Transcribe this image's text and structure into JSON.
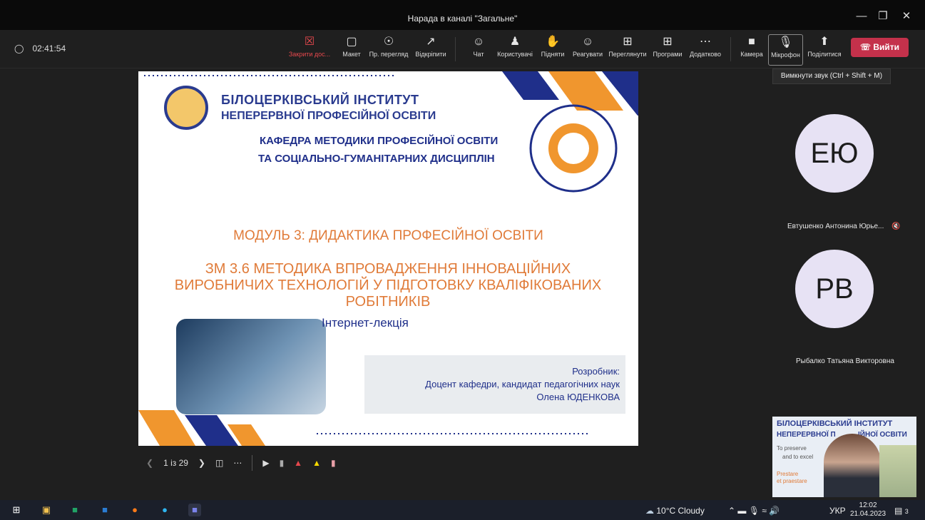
{
  "window": {
    "title": "Нарада в каналі \"Загальне\""
  },
  "meeting": {
    "elapsed": "02:41:54"
  },
  "toolbar": {
    "close_share": "Закрити дос...",
    "layout": "Макет",
    "preview": "Пр. перегляд",
    "popout": "Відкріпити",
    "chat": "Чат",
    "people": "Користувачі",
    "raise": "Підняти",
    "react": "Реагувати",
    "view": "Переглянути",
    "apps": "Програми",
    "more": "Додатково",
    "camera": "Камера",
    "mic": "Мікрофон",
    "share": "Поділитися",
    "leave": "Вийти"
  },
  "tooltip": {
    "text": "Вимкнути звук (Ctrl + Shift + M)"
  },
  "slide": {
    "inst_line1": "БІЛОЦЕРКІВСЬКИЙ ІНСТИТУТ",
    "inst_line2": "НЕПЕРЕРВНОЇ ПРОФЕСІЙНОЇ ОСВІТИ",
    "dept_line1": "КАФЕДРА МЕТОДИКИ ПРОФЕСІЙНОЇ ОСВІТИ",
    "dept_line2": "ТА СОЦІАЛЬНО-ГУМАНІТАРНИХ ДИСЦИПЛІН",
    "module": "МОДУЛЬ 3: ДИДАКТИКА ПРОФЕСІЙНОЇ ОСВІТИ",
    "topic": "ЗМ 3.6 МЕТОДИКА ВПРОВАДЖЕННЯ ІННОВАЦІЙНИХ ВИРОБНИЧИХ ТЕХНОЛОГІЙ У ПІДГОТОВКУ КВАЛІФІКОВАНИХ РОБІТНИКІВ",
    "lecture_type": "Інтернет-лекція",
    "author_role_label": "Розробник:",
    "author_position": "Доцент кафедри, кандидат педагогічних наук",
    "author_name": "Олена ЮДЕНКОВА"
  },
  "presenter_controls": {
    "page": "1 із 29"
  },
  "participants": [
    {
      "initials": "ЕЮ",
      "name": "Евтушенко Антонина Юрье..."
    },
    {
      "initials": "РВ",
      "name": "Рыбалко Татьяна Викторовна"
    }
  ],
  "self_view": {
    "line1": "БІЛОЦЕРКІВСЬКИЙ ІНСТИТУТ",
    "line2": "НЕПЕРЕРВНОЇ П",
    "line2b": "ІЙНОЇ ОСВІТИ",
    "text1": "To preserve",
    "text2": "and to excel",
    "text3": "Prestare",
    "text4": "et praestare"
  },
  "taskbar": {
    "weather": "10°C Cloudy",
    "lang": "УКР",
    "time": "12:02",
    "date": "21.04.2023",
    "notifications": "3"
  },
  "colors": {
    "leave": "#c4314b",
    "slide_orange": "#e07b39",
    "slide_blue": "#1f2f8a"
  }
}
